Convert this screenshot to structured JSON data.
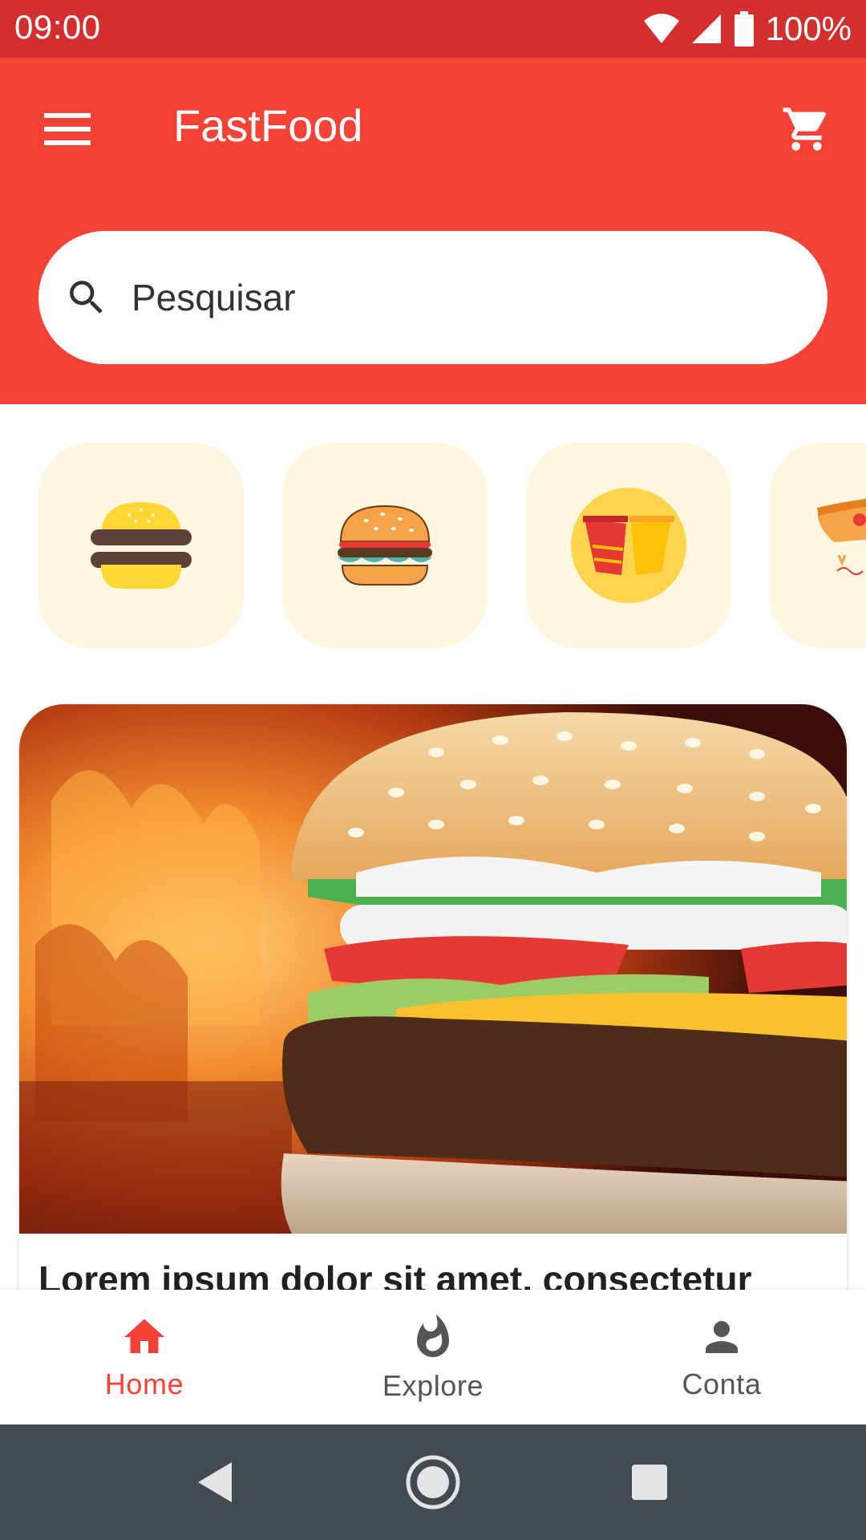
{
  "status_bar": {
    "time": "09:00",
    "battery": "100%",
    "icons": [
      "wifi-icon",
      "signal-icon",
      "battery-icon"
    ]
  },
  "app_bar": {
    "title": "FastFood",
    "menu_icon": "menu-icon",
    "cart_icon": "cart-icon",
    "background": "#f44336"
  },
  "search": {
    "placeholder": "Pesquisar",
    "icon": "search-icon"
  },
  "categories": [
    {
      "icon": "burger-simple-icon"
    },
    {
      "icon": "burger-detailed-icon"
    },
    {
      "icon": "fries-cups-icon"
    },
    {
      "icon": "pizza-icon"
    }
  ],
  "card": {
    "image": "burger-fire-photo",
    "title": "Lorem ipsum dolor sit amet, consectetur"
  },
  "bottom_nav": {
    "items": [
      {
        "label": "Home",
        "icon": "home-icon",
        "active": true
      },
      {
        "label": "Explore",
        "icon": "flame-icon",
        "active": false
      },
      {
        "label": "Conta",
        "icon": "person-icon",
        "active": false
      }
    ],
    "active_color": "#f44336"
  },
  "system_nav": {
    "buttons": [
      "back-icon",
      "home-circle-icon",
      "recents-icon"
    ]
  }
}
